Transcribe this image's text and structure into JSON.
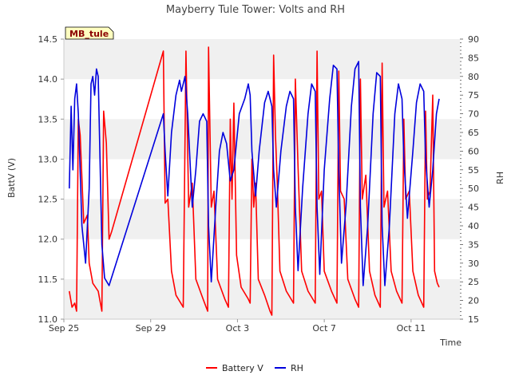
{
  "chart_data": {
    "type": "line",
    "title": "Mayberry Tule Tower: Volts and RH",
    "site_label": "MB_tule",
    "xlabel": "Time",
    "ylabel_left": "BattV (V)",
    "ylabel_right": "RH",
    "xlim": [
      "2023-09-25T00:00",
      "2023-10-13T06:00"
    ],
    "ylim_left": [
      11.0,
      14.5
    ],
    "ylim_right": [
      15,
      90
    ],
    "x_ticks": [
      {
        "date": "2023-09-25",
        "label": "Sep 25"
      },
      {
        "date": "2023-09-29",
        "label": "Sep 29"
      },
      {
        "date": "2023-10-03",
        "label": "Oct 3"
      },
      {
        "date": "2023-10-07",
        "label": "Oct 7"
      },
      {
        "date": "2023-10-11",
        "label": "Oct 11"
      }
    ],
    "y_ticks_left": [
      "11.0",
      "11.5",
      "12.0",
      "12.5",
      "13.0",
      "13.5",
      "14.0",
      "14.5"
    ],
    "y_ticks_right": [
      "15",
      "20",
      "25",
      "30",
      "35",
      "40",
      "45",
      "50",
      "55",
      "60",
      "65",
      "70",
      "75",
      "80",
      "85",
      "90"
    ],
    "grid": "horizontal-bands",
    "legend_position": "bottom",
    "colors": {
      "battery": "#ff0000",
      "rh": "#0000dd",
      "band": "#f0f0f0",
      "site_fill": "#ffffc0"
    },
    "series": [
      {
        "name": "Battery V",
        "axis": "left",
        "points": [
          [
            "2023-09-25T06:00",
            11.35
          ],
          [
            "2023-09-25T09:00",
            11.15
          ],
          [
            "2023-09-25T12:00",
            11.2
          ],
          [
            "2023-09-25T14:00",
            11.1
          ],
          [
            "2023-09-25T16:00",
            13.5
          ],
          [
            "2023-09-25T18:00",
            13.3
          ],
          [
            "2023-09-25T22:00",
            12.2
          ],
          [
            "2023-09-26T02:00",
            12.3
          ],
          [
            "2023-09-26T04:00",
            11.7
          ],
          [
            "2023-09-26T08:00",
            11.45
          ],
          [
            "2023-09-26T14:00",
            11.35
          ],
          [
            "2023-09-26T18:00",
            11.1
          ],
          [
            "2023-09-26T20:00",
            13.6
          ],
          [
            "2023-09-26T23:00",
            13.2
          ],
          [
            "2023-09-27T02:00",
            12.0
          ],
          [
            "2023-09-27T05:00",
            12.1
          ],
          [
            "2023-09-29T14:00",
            14.35
          ],
          [
            "2023-09-29T16:00",
            12.45
          ],
          [
            "2023-09-29T19:00",
            12.5
          ],
          [
            "2023-09-29T23:00",
            11.6
          ],
          [
            "2023-09-30T04:00",
            11.3
          ],
          [
            "2023-09-30T12:00",
            11.15
          ],
          [
            "2023-09-30T15:00",
            14.35
          ],
          [
            "2023-09-30T18:00",
            12.4
          ],
          [
            "2023-09-30T22:00",
            12.7
          ],
          [
            "2023-10-01T02:00",
            11.5
          ],
          [
            "2023-10-01T10:00",
            11.25
          ],
          [
            "2023-10-01T15:00",
            11.1
          ],
          [
            "2023-10-01T16:00",
            14.4
          ],
          [
            "2023-10-01T19:00",
            12.4
          ],
          [
            "2023-10-01T22:00",
            12.6
          ],
          [
            "2023-10-02T02:00",
            11.5
          ],
          [
            "2023-10-02T10:00",
            11.25
          ],
          [
            "2023-10-02T14:00",
            11.15
          ],
          [
            "2023-10-02T16:00",
            13.5
          ],
          [
            "2023-10-02T18:00",
            12.5
          ],
          [
            "2023-10-02T20:00",
            13.7
          ],
          [
            "2023-10-02T23:00",
            11.8
          ],
          [
            "2023-10-03T04:00",
            11.4
          ],
          [
            "2023-10-03T12:00",
            11.25
          ],
          [
            "2023-10-03T14:00",
            11.2
          ],
          [
            "2023-10-03T16:00",
            13.0
          ],
          [
            "2023-10-03T18:00",
            12.4
          ],
          [
            "2023-10-03T20:00",
            12.7
          ],
          [
            "2023-10-03T23:00",
            11.5
          ],
          [
            "2023-10-04T06:00",
            11.3
          ],
          [
            "2023-10-04T12:00",
            11.1
          ],
          [
            "2023-10-04T14:00",
            11.05
          ],
          [
            "2023-10-04T16:00",
            14.3
          ],
          [
            "2023-10-04T18:00",
            13.3
          ],
          [
            "2023-10-04T20:00",
            12.7
          ],
          [
            "2023-10-04T23:00",
            11.6
          ],
          [
            "2023-10-05T06:00",
            11.35
          ],
          [
            "2023-10-05T14:00",
            11.2
          ],
          [
            "2023-10-05T16:00",
            14.0
          ],
          [
            "2023-10-05T19:00",
            12.9
          ],
          [
            "2023-10-05T23:00",
            11.6
          ],
          [
            "2023-10-06T06:00",
            11.35
          ],
          [
            "2023-10-06T14:00",
            11.2
          ],
          [
            "2023-10-06T16:00",
            14.35
          ],
          [
            "2023-10-06T18:00",
            12.5
          ],
          [
            "2023-10-06T21:00",
            12.6
          ],
          [
            "2023-10-07T00:00",
            11.6
          ],
          [
            "2023-10-07T08:00",
            11.35
          ],
          [
            "2023-10-07T14:00",
            11.2
          ],
          [
            "2023-10-07T16:00",
            14.1
          ],
          [
            "2023-10-07T18:00",
            12.6
          ],
          [
            "2023-10-07T22:00",
            12.5
          ],
          [
            "2023-10-08T02:00",
            11.5
          ],
          [
            "2023-10-08T10:00",
            11.25
          ],
          [
            "2023-10-08T14:00",
            11.15
          ],
          [
            "2023-10-08T16:00",
            14.0
          ],
          [
            "2023-10-08T18:00",
            12.5
          ],
          [
            "2023-10-08T22:00",
            12.8
          ],
          [
            "2023-10-09T02:00",
            11.6
          ],
          [
            "2023-10-09T08:00",
            11.3
          ],
          [
            "2023-10-09T14:00",
            11.15
          ],
          [
            "2023-10-09T16:00",
            14.2
          ],
          [
            "2023-10-09T18:00",
            12.4
          ],
          [
            "2023-10-09T22:00",
            12.6
          ],
          [
            "2023-10-10T02:00",
            11.6
          ],
          [
            "2023-10-10T08:00",
            11.35
          ],
          [
            "2023-10-10T14:00",
            11.2
          ],
          [
            "2023-10-10T16:00",
            13.5
          ],
          [
            "2023-10-10T18:00",
            12.5
          ],
          [
            "2023-10-10T22:00",
            12.6
          ],
          [
            "2023-10-11T02:00",
            11.6
          ],
          [
            "2023-10-11T08:00",
            11.3
          ],
          [
            "2023-10-11T14:00",
            11.15
          ],
          [
            "2023-10-11T16:00",
            13.6
          ],
          [
            "2023-10-11T18:00",
            12.5
          ],
          [
            "2023-10-11T21:00",
            12.6
          ],
          [
            "2023-10-12T00:00",
            13.8
          ],
          [
            "2023-10-12T02:00",
            11.6
          ],
          [
            "2023-10-12T05:00",
            11.45
          ],
          [
            "2023-10-12T07:00",
            11.4
          ]
        ]
      },
      {
        "name": "RH",
        "axis": "right",
        "points": [
          [
            "2023-09-25T06:00",
            50
          ],
          [
            "2023-09-25T08:00",
            72
          ],
          [
            "2023-09-25T10:00",
            55
          ],
          [
            "2023-09-25T12:00",
            74
          ],
          [
            "2023-09-25T14:00",
            78
          ],
          [
            "2023-09-25T16:00",
            70
          ],
          [
            "2023-09-25T20:00",
            40
          ],
          [
            "2023-09-26T00:00",
            30
          ],
          [
            "2023-09-26T04:00",
            50
          ],
          [
            "2023-09-26T06:00",
            78
          ],
          [
            "2023-09-26T08:00",
            80
          ],
          [
            "2023-09-26T10:00",
            75
          ],
          [
            "2023-09-26T12:00",
            82
          ],
          [
            "2023-09-26T14:00",
            80
          ],
          [
            "2023-09-26T18:00",
            35
          ],
          [
            "2023-09-26T21:00",
            26
          ],
          [
            "2023-09-27T02:00",
            24
          ],
          [
            "2023-09-29T14:00",
            70
          ],
          [
            "2023-09-29T16:00",
            60
          ],
          [
            "2023-09-29T19:00",
            48
          ],
          [
            "2023-09-29T23:00",
            65
          ],
          [
            "2023-09-30T04:00",
            75
          ],
          [
            "2023-09-30T08:00",
            79
          ],
          [
            "2023-09-30T10:00",
            76
          ],
          [
            "2023-09-30T14:00",
            80
          ],
          [
            "2023-09-30T17:00",
            70
          ],
          [
            "2023-09-30T22:00",
            45
          ],
          [
            "2023-10-01T02:00",
            55
          ],
          [
            "2023-10-01T06:00",
            68
          ],
          [
            "2023-10-01T10:00",
            70
          ],
          [
            "2023-10-01T14:00",
            68
          ],
          [
            "2023-10-01T16:00",
            40
          ],
          [
            "2023-10-01T19:00",
            25
          ],
          [
            "2023-10-02T00:00",
            45
          ],
          [
            "2023-10-02T04:00",
            60
          ],
          [
            "2023-10-02T08:00",
            65
          ],
          [
            "2023-10-02T12:00",
            62
          ],
          [
            "2023-10-02T16:00",
            52
          ],
          [
            "2023-10-02T20:00",
            55
          ],
          [
            "2023-10-03T02:00",
            70
          ],
          [
            "2023-10-03T08:00",
            74
          ],
          [
            "2023-10-03T12:00",
            78
          ],
          [
            "2023-10-03T14:00",
            75
          ],
          [
            "2023-10-03T16:00",
            60
          ],
          [
            "2023-10-03T20:00",
            48
          ],
          [
            "2023-10-04T00:00",
            60
          ],
          [
            "2023-10-04T06:00",
            73
          ],
          [
            "2023-10-04T10:00",
            76
          ],
          [
            "2023-10-04T14:00",
            72
          ],
          [
            "2023-10-04T16:00",
            55
          ],
          [
            "2023-10-04T19:00",
            45
          ],
          [
            "2023-10-05T00:00",
            60
          ],
          [
            "2023-10-05T06:00",
            72
          ],
          [
            "2023-10-05T10:00",
            76
          ],
          [
            "2023-10-05T14:00",
            74
          ],
          [
            "2023-10-05T16:00",
            45
          ],
          [
            "2023-10-05T19:00",
            28
          ],
          [
            "2023-10-06T00:00",
            50
          ],
          [
            "2023-10-06T06:00",
            70
          ],
          [
            "2023-10-06T10:00",
            78
          ],
          [
            "2023-10-06T14:00",
            76
          ],
          [
            "2023-10-06T16:00",
            45
          ],
          [
            "2023-10-06T19:00",
            27
          ],
          [
            "2023-10-07T00:00",
            55
          ],
          [
            "2023-10-07T06:00",
            74
          ],
          [
            "2023-10-07T10:00",
            83
          ],
          [
            "2023-10-07T14:00",
            82
          ],
          [
            "2023-10-07T16:00",
            55
          ],
          [
            "2023-10-07T19:00",
            30
          ],
          [
            "2023-10-08T00:00",
            45
          ],
          [
            "2023-10-08T06:00",
            72
          ],
          [
            "2023-10-08T10:00",
            82
          ],
          [
            "2023-10-08T14:00",
            84
          ],
          [
            "2023-10-08T16:00",
            45
          ],
          [
            "2023-10-08T19:00",
            24
          ],
          [
            "2023-10-09T00:00",
            40
          ],
          [
            "2023-10-09T06:00",
            70
          ],
          [
            "2023-10-09T10:00",
            81
          ],
          [
            "2023-10-09T14:00",
            80
          ],
          [
            "2023-10-09T16:00",
            40
          ],
          [
            "2023-10-09T19:00",
            24
          ],
          [
            "2023-10-10T00:00",
            40
          ],
          [
            "2023-10-10T06:00",
            70
          ],
          [
            "2023-10-10T10:00",
            78
          ],
          [
            "2023-10-10T14:00",
            74
          ],
          [
            "2023-10-10T16:00",
            58
          ],
          [
            "2023-10-10T20:00",
            42
          ],
          [
            "2023-10-11T02:00",
            60
          ],
          [
            "2023-10-11T06:00",
            73
          ],
          [
            "2023-10-11T10:00",
            78
          ],
          [
            "2023-10-11T14:00",
            76
          ],
          [
            "2023-10-11T16:00",
            58
          ],
          [
            "2023-10-11T20:00",
            45
          ],
          [
            "2023-10-12T00:00",
            55
          ],
          [
            "2023-10-12T04:00",
            70
          ],
          [
            "2023-10-12T07:00",
            74
          ]
        ]
      }
    ]
  }
}
